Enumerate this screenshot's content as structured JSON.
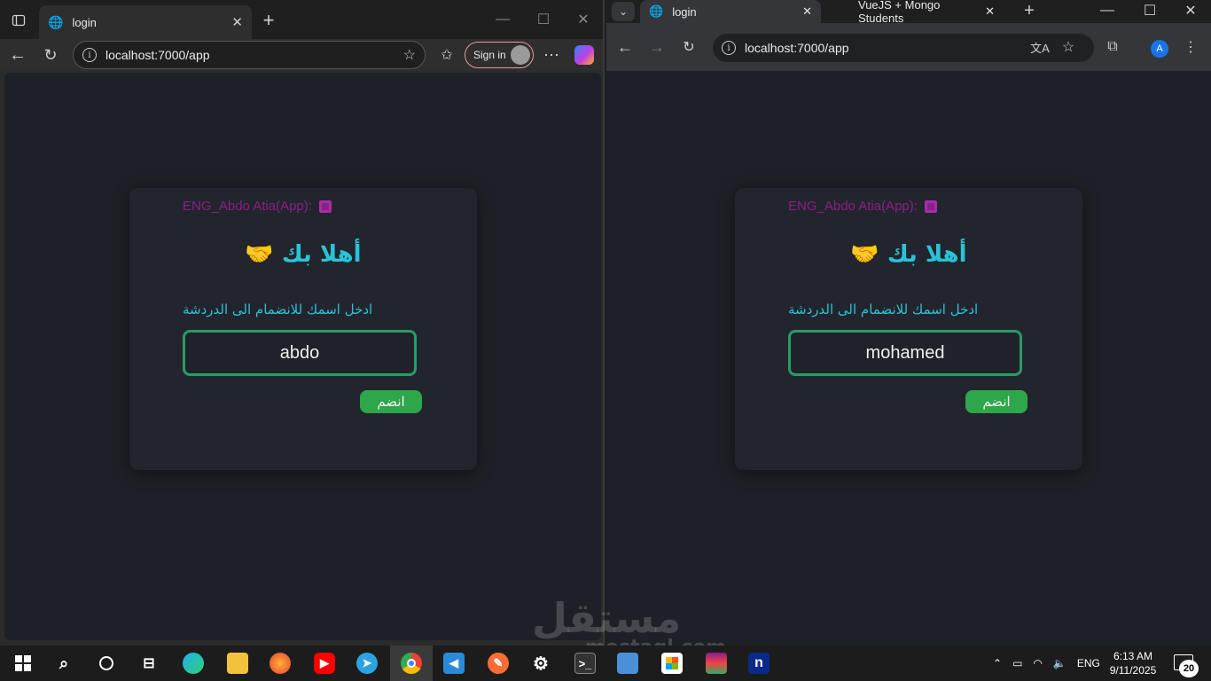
{
  "left_browser": {
    "tab_title": "login",
    "url": "localhost:7000/app",
    "signin_label": "Sign in",
    "new_tab": "+"
  },
  "right_browser": {
    "tabs": [
      {
        "title": "login",
        "active": true
      },
      {
        "title": "VueJS + Mongo Students",
        "active": false
      }
    ],
    "url": "localhost:7000/app",
    "avatar_letter": "A"
  },
  "login_card": {
    "credit": "ENG_Abdo Atia(App):",
    "welcome": "أهلا بك 🤝",
    "prompt": "ادخل اسمك للانضمام الى الدردشة",
    "join_label": "انضم"
  },
  "left_login": {
    "name_value": "abdo"
  },
  "right_login": {
    "name_value": "mohamed"
  },
  "taskbar": {
    "language": "ENG",
    "time": "6:13 AM",
    "date": "9/11/2025",
    "notifications": "20"
  },
  "watermark": {
    "main": "مستقل",
    "sub": "mostaql.com"
  },
  "colors": {
    "accent_cyan": "#29c3d8",
    "credit_purple": "#8a1f8a",
    "input_border": "#2a9a6a",
    "button_green": "#2ea64a"
  }
}
